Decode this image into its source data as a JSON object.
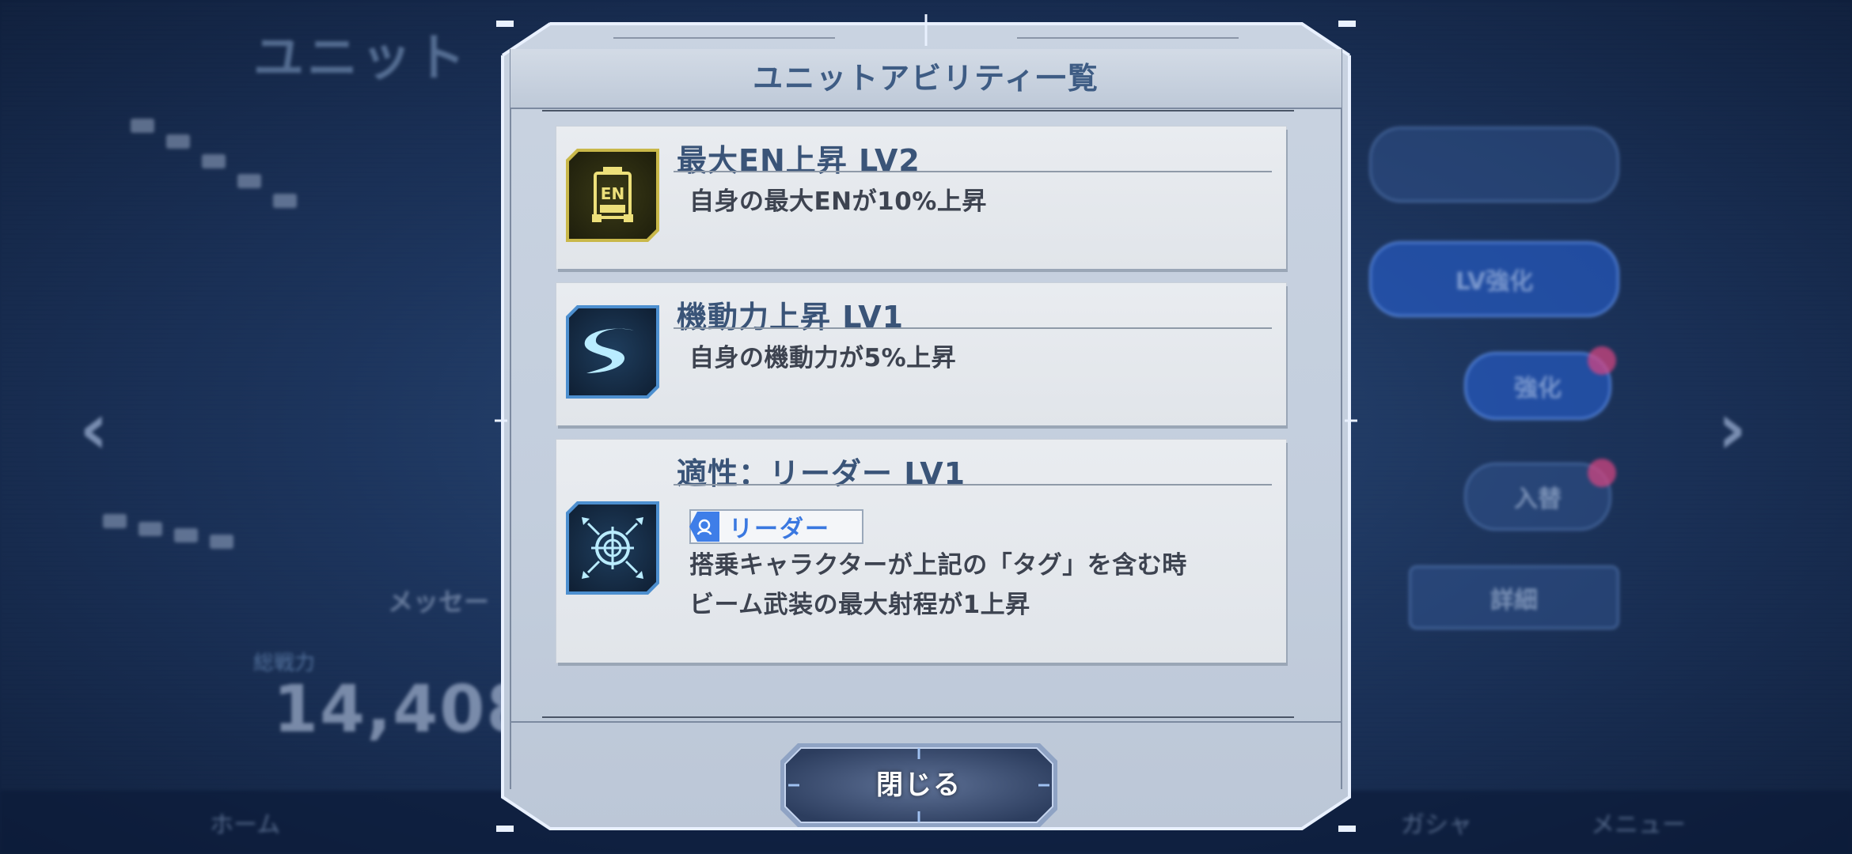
{
  "background": {
    "screen_title": "ユニット",
    "power_label": "総戦力",
    "power_value": "14,408",
    "message_label": "メッセー",
    "pills": [
      "LV強化",
      "強化",
      "入替",
      "詳細"
    ],
    "bottom_nav": [
      "ホーム",
      "ガシャ",
      "メニュー"
    ],
    "nav_left_arrow": "‹",
    "nav_right_arrow": "›"
  },
  "dialog": {
    "title": "ユニットアビリティ一覧",
    "abilities": [
      {
        "icon": "en-battery-icon",
        "icon_text": "EN",
        "name": "最大EN上昇 LV2",
        "description": "自身の最大ENが10%上昇"
      },
      {
        "icon": "mobility-swoosh-icon",
        "name": "機動力上昇 LV1",
        "description": "自身の機動力が5%上昇"
      },
      {
        "icon": "crosshair-icon",
        "name": "適性：リーダー LV1",
        "tag": "リーダー",
        "description_line1": "搭乗キャラクターが上記の「タグ」を含む時",
        "description_line2": "ビーム武装の最大射程が1上昇"
      }
    ],
    "close_label": "閉じる"
  },
  "colors": {
    "panel": "#c9d3e1",
    "title_text": "#3e5c84",
    "tag_blue": "#3a78e0",
    "en_gold": "#c9b84a",
    "icon_blue": "#4d8fcf"
  }
}
